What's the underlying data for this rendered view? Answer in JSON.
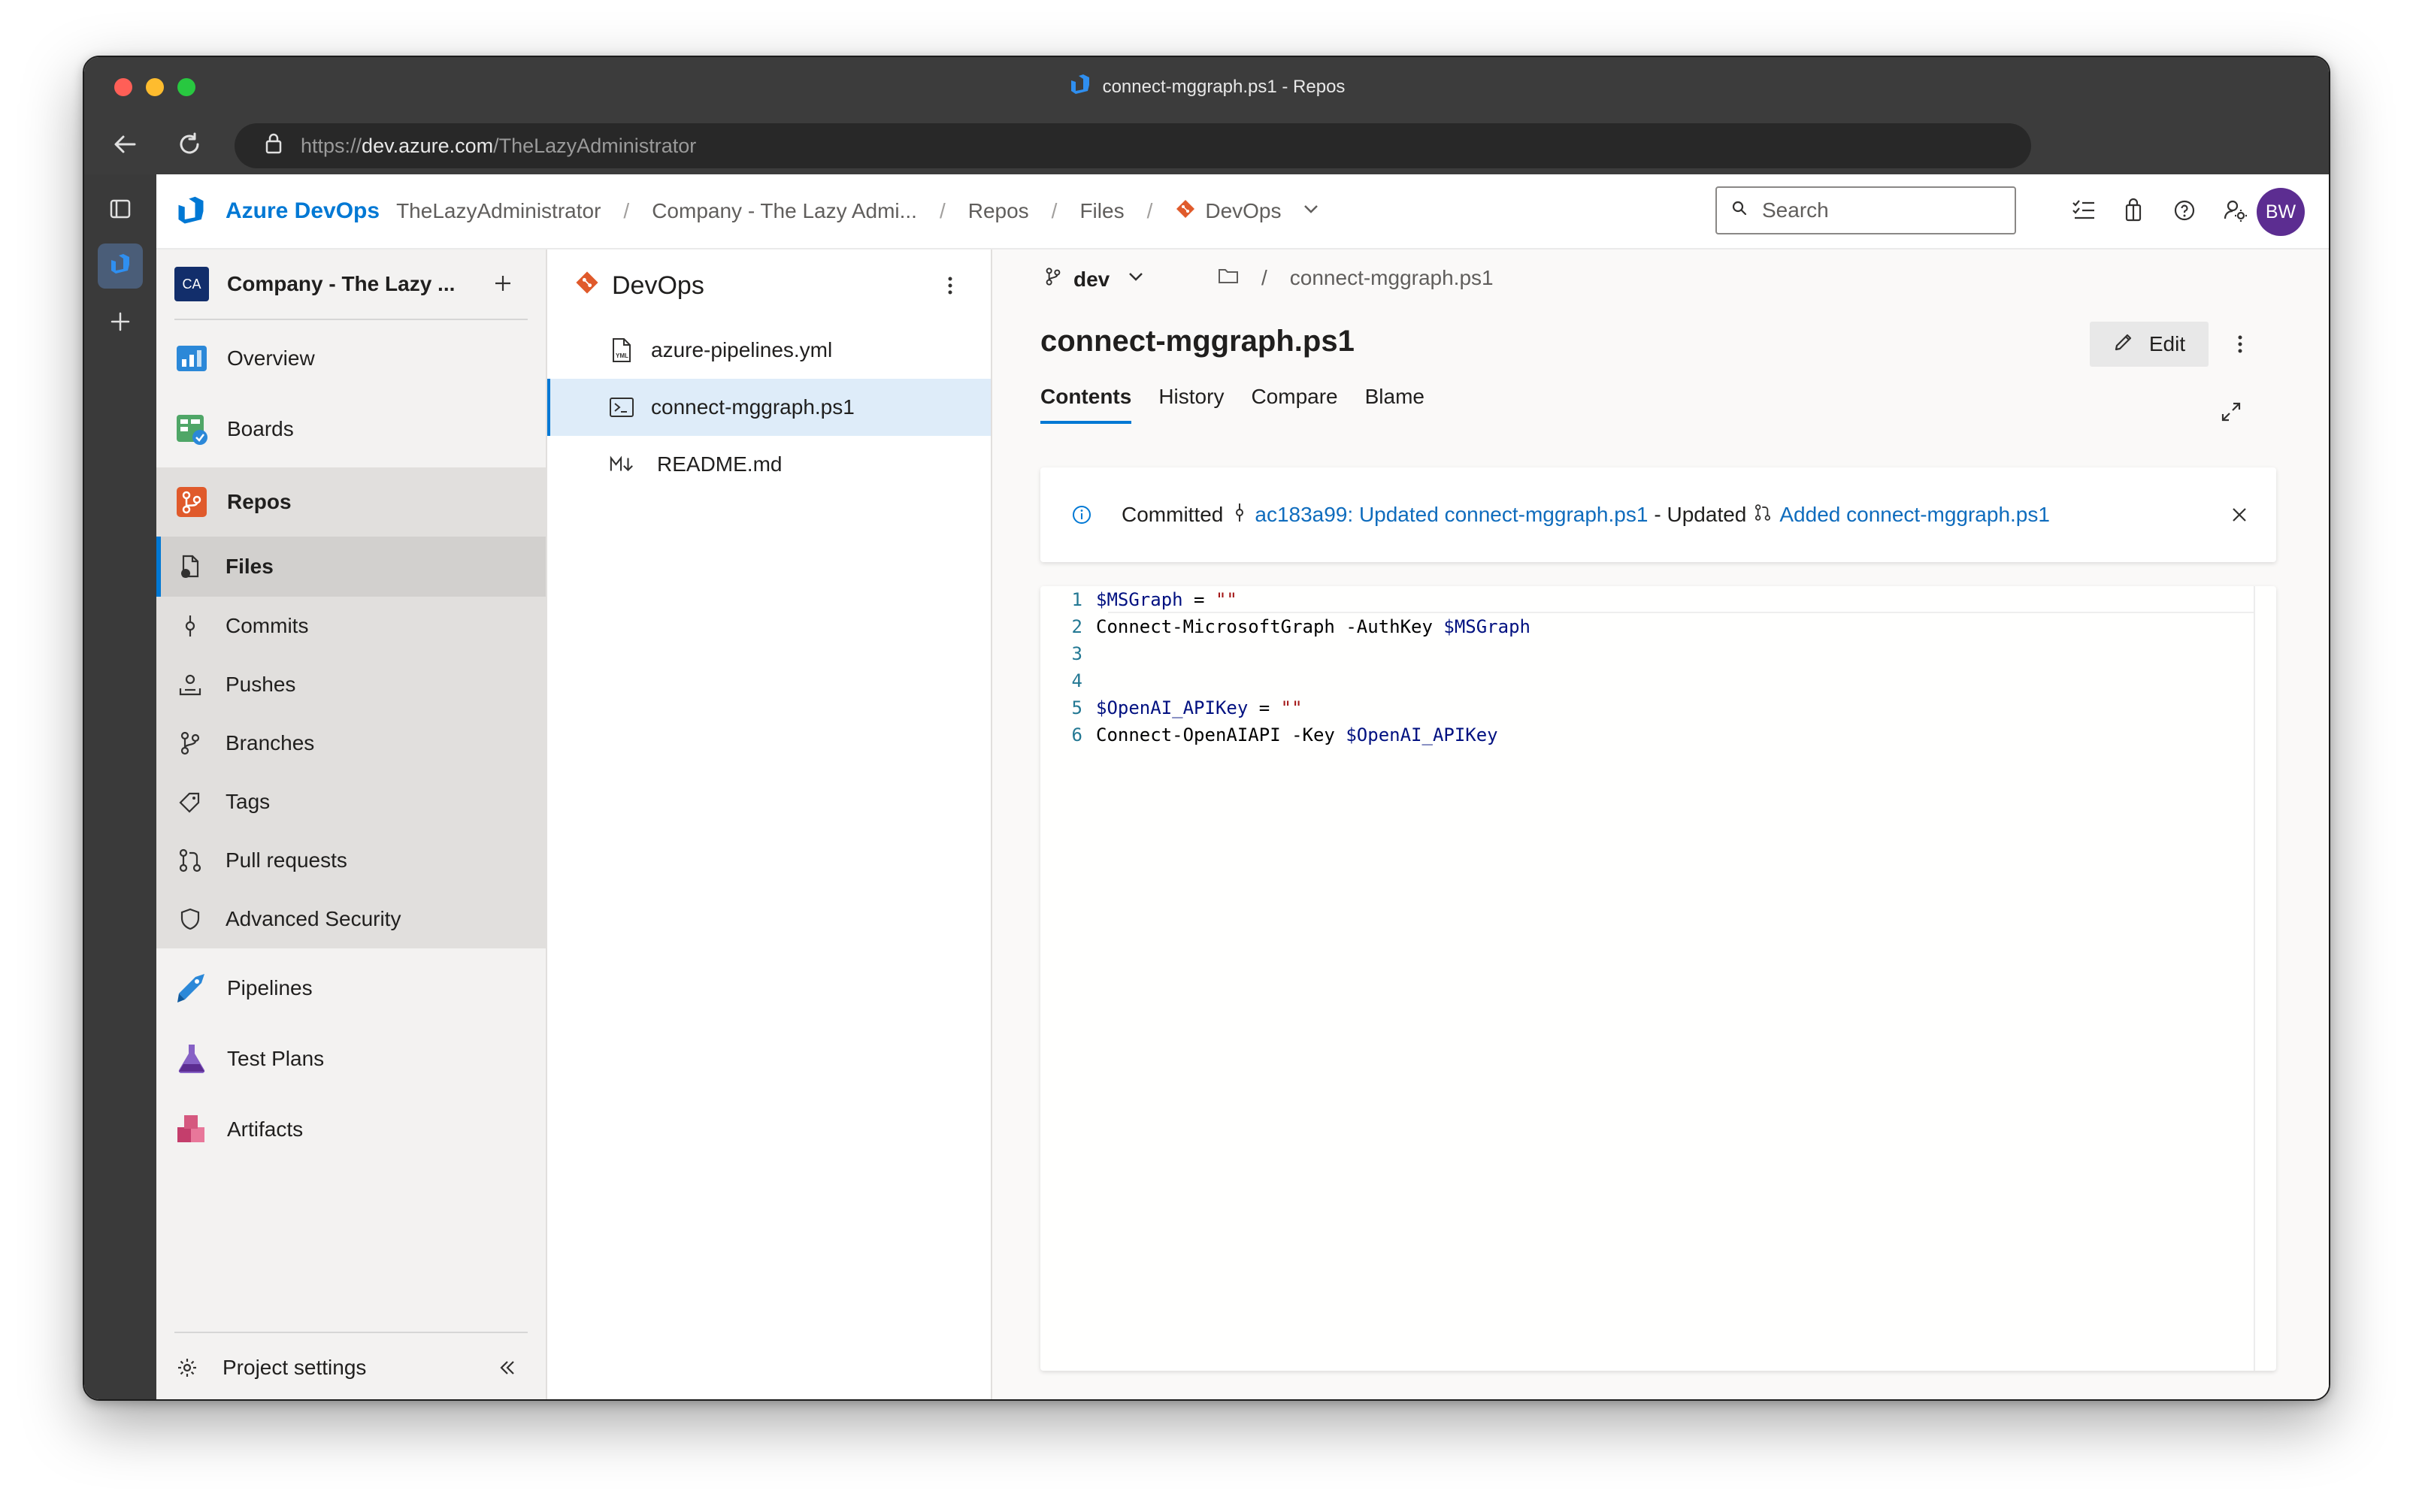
{
  "browser": {
    "window_title": "connect-mggraph.ps1 - Repos",
    "url_prefix": "https://",
    "url_host": "dev.azure.com",
    "url_path": "/TheLazyAdministrator"
  },
  "topbar": {
    "brand": "Azure DevOps",
    "org": "TheLazyAdministrator",
    "project": "Company - The Lazy Admi...",
    "section": "Repos",
    "subsection": "Files",
    "repo": "DevOps",
    "separator": "/",
    "search_placeholder": "Search",
    "avatar_initials": "BW"
  },
  "sidebar": {
    "project_initials": "CA",
    "project_name": "Company - The Lazy ...",
    "items": [
      {
        "label": "Overview"
      },
      {
        "label": "Boards"
      },
      {
        "label": "Repos"
      },
      {
        "label": "Files"
      },
      {
        "label": "Commits"
      },
      {
        "label": "Pushes"
      },
      {
        "label": "Branches"
      },
      {
        "label": "Tags"
      },
      {
        "label": "Pull requests"
      },
      {
        "label": "Advanced Security"
      },
      {
        "label": "Pipelines"
      },
      {
        "label": "Test Plans"
      },
      {
        "label": "Artifacts"
      }
    ],
    "footer_label": "Project settings"
  },
  "files_panel": {
    "repo_name": "DevOps",
    "files": [
      {
        "name": "azure-pipelines.yml"
      },
      {
        "name": "connect-mggraph.ps1"
      },
      {
        "name": "README.md"
      }
    ]
  },
  "main": {
    "branch": "dev",
    "path_sep": "/",
    "path_file": "connect-mggraph.ps1",
    "title": "connect-mggraph.ps1",
    "edit_label": "Edit",
    "tabs": [
      {
        "label": "Contents"
      },
      {
        "label": "History"
      },
      {
        "label": "Compare"
      },
      {
        "label": "Blame"
      }
    ],
    "info": {
      "committed": "Committed",
      "commit_link": "ac183a99: Updated connect-mggraph.ps1",
      "updated": "- Updated",
      "pr_link": "Added connect-mggraph.ps1"
    },
    "code": {
      "line_numbers": [
        "1",
        "2",
        "3",
        "4",
        "5",
        "6"
      ],
      "l1_var": "$MSGraph",
      "l1_op": " = ",
      "l1_str": "\"\"",
      "l2_text": "Connect-MicrosoftGraph -AuthKey ",
      "l2_var": "$MSGraph",
      "l5_var": "$OpenAI_APIKey",
      "l5_op": " = ",
      "l5_str": "\"\"",
      "l6_text": "Connect-OpenAIAPI -Key ",
      "l6_var": "$OpenAI_APIKey"
    }
  },
  "colors": {
    "accent": "#0078d4",
    "link": "#0f6cbd",
    "avatar": "#5c2d91",
    "repos_orange": "#e05a2b",
    "selected_file_bg": "#deecf9"
  }
}
